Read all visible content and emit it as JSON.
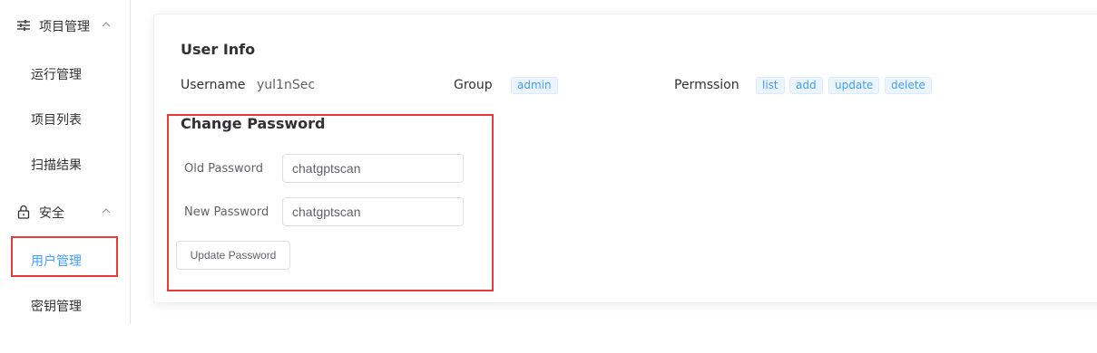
{
  "sidebar": {
    "groups": [
      {
        "label": "项目管理",
        "icon": "sliders-icon",
        "items": [
          "运行管理",
          "项目列表",
          "扫描结果"
        ]
      },
      {
        "label": "安全",
        "icon": "lock-icon",
        "items": [
          "用户管理",
          "密钥管理"
        ]
      }
    ],
    "active_item": "用户管理"
  },
  "user_info": {
    "title": "User Info",
    "username_label": "Username",
    "username_value": "yul1nSec",
    "group_label": "Group",
    "group_tag": "admin",
    "permission_label": "Permssion",
    "permissions": [
      "list",
      "add",
      "update",
      "delete"
    ]
  },
  "change_password": {
    "title": "Change Password",
    "old_label": "Old Password",
    "old_value": "chatgptscan",
    "new_label": "New Password",
    "new_value": "chatgptscan",
    "button_label": "Update Password"
  },
  "colors": {
    "accent": "#409eff",
    "highlight": "#e83a3a"
  }
}
